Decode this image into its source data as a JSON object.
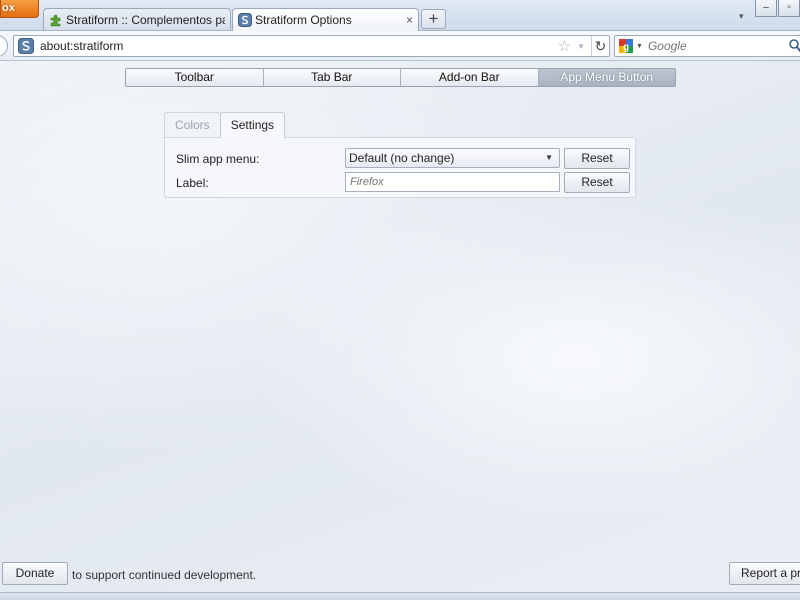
{
  "window": {
    "app_button_label": "ox",
    "minimize_glyph": "–",
    "restore_glyph": "▫",
    "tabs": [
      {
        "label": "Stratiform :: Complementos par...",
        "icon": "puzzle-piece-icon"
      },
      {
        "label": "Stratiform Options",
        "icon": "stratiform-s-icon",
        "close": "×"
      }
    ],
    "new_tab_glyph": "+",
    "tab_list_glyph": "▾"
  },
  "navbar": {
    "url": "about:stratiform",
    "search_placeholder": "Google",
    "bookmark_star": "☆",
    "history_drop": "▼",
    "reload_glyph": "↻",
    "engine_drop": "▼"
  },
  "options": {
    "sections": [
      {
        "label": "Toolbar",
        "selected": false
      },
      {
        "label": "Tab Bar",
        "selected": false
      },
      {
        "label": "Add-on Bar",
        "selected": false
      },
      {
        "label": "App Menu Button",
        "selected": true
      }
    ],
    "subtabs": [
      {
        "label": "Colors",
        "active": false
      },
      {
        "label": "Settings",
        "active": true
      }
    ],
    "settings": {
      "slim_menu_label": "Slim app menu:",
      "slim_menu_value": "Default (no change)",
      "slim_menu_arrow": "▼",
      "label_label": "Label:",
      "label_placeholder": "Firefox",
      "reset_label": "Reset"
    }
  },
  "footer": {
    "donate_label": "Donate",
    "donate_text": "to support continued development.",
    "report_label": "Report a pro"
  },
  "colors": {
    "accent_orange": "#e56d0f",
    "selected_segment": "#aab4c1",
    "background": "#e7ecf2"
  }
}
